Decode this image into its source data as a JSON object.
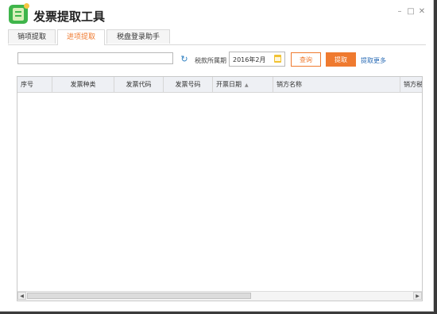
{
  "app": {
    "title": "发票提取工具"
  },
  "window_controls": {
    "minimize": "–",
    "maximize": "□",
    "close": "✕"
  },
  "tabs": [
    {
      "label": "销项提取",
      "active": false
    },
    {
      "label": "进项提取",
      "active": true
    },
    {
      "label": "税盘登录助手",
      "active": false
    }
  ],
  "toolbar": {
    "search_value": "",
    "period_label": "税款所属期",
    "period_value": "2016年2月",
    "query_label": "查询",
    "extract_label": "提取",
    "extract_more_label": "提取更多"
  },
  "grid": {
    "columns": [
      "序号",
      "发票种类",
      "发票代码",
      "发票号码",
      "开票日期",
      "销方名称",
      "销方税..."
    ],
    "rows": []
  },
  "colors": {
    "accent": "#ef7a2f",
    "link": "#2a6bb5",
    "brand": "#3fb54b"
  },
  "icons": [
    "app-logo-icon",
    "refresh-icon",
    "calendar-icon",
    "sort-icon",
    "scroll-left-icon",
    "scroll-right-icon"
  ]
}
